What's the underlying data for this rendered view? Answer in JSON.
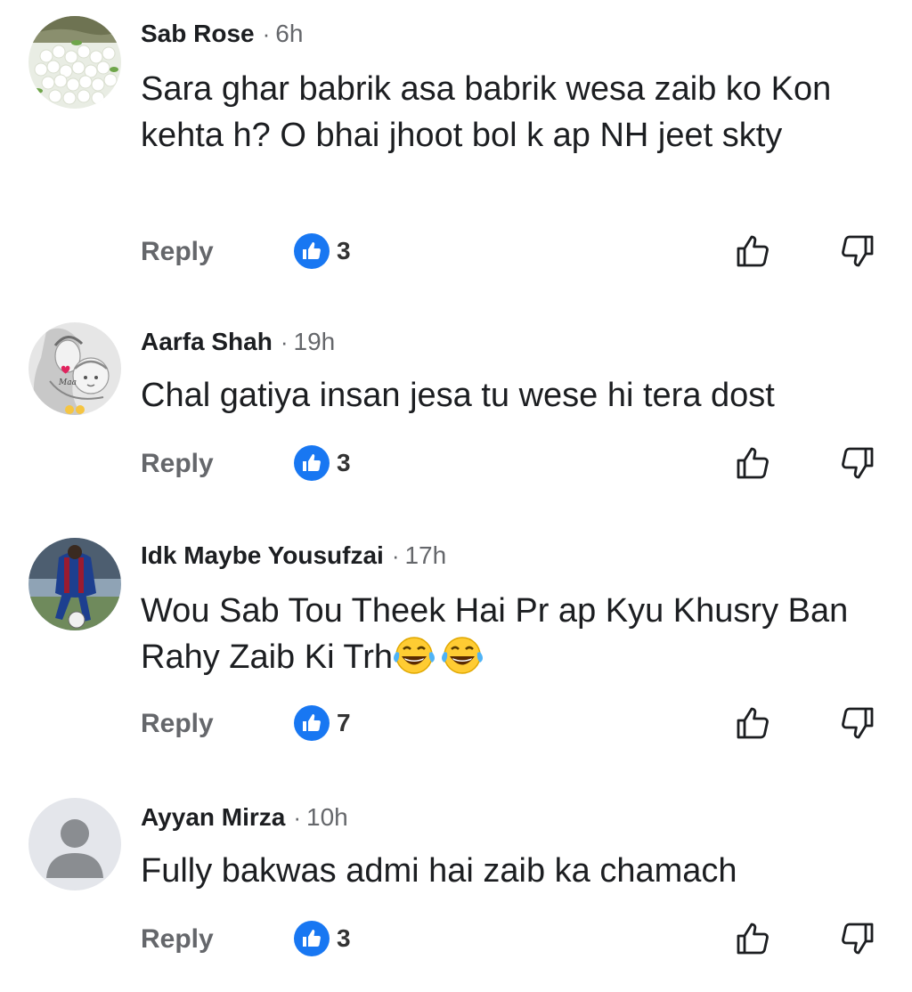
{
  "comments": [
    {
      "author": "Sab Rose",
      "separator": "·",
      "time": "6h",
      "text": "Sara ghar babrik asa babrik wesa zaib ko Kon kehta h? O bhai jhoot bol k ap NH jeet skty",
      "reply_label": "Reply",
      "like_count": "3",
      "avatar_icon": "flower-photo-avatar"
    },
    {
      "author": "Aarfa Shah",
      "separator": "·",
      "time": "19h",
      "text": "Chal gatiya insan jesa tu wese hi tera dost",
      "reply_label": "Reply",
      "like_count": "3",
      "avatar_icon": "mother-child-sketch-avatar"
    },
    {
      "author": "Idk Maybe Yousufzai",
      "separator": "·",
      "time": "17h",
      "text": "Wou Sab Tou Theek Hai Pr ap Kyu Khusry Ban Rahy Zaib Ki Trh",
      "emoji": "😂😂",
      "reply_label": "Reply",
      "like_count": "7",
      "avatar_icon": "football-player-avatar"
    },
    {
      "author": "Ayyan Mirza",
      "separator": "·",
      "time": "10h",
      "text": "Fully bakwas admi hai zaib ka chamach",
      "reply_label": "Reply",
      "like_count": "3",
      "avatar_icon": "default-person-avatar"
    }
  ],
  "colors": {
    "like_blue": "#1877f2",
    "secondary_text": "#65676b",
    "primary_text": "#1c1e21"
  },
  "icons": {
    "like_badge": "thumbs-up-icon",
    "upvote": "thumb-up-outline-icon",
    "downvote": "thumb-down-outline-icon",
    "emoji": "tears-of-joy-emoji"
  }
}
